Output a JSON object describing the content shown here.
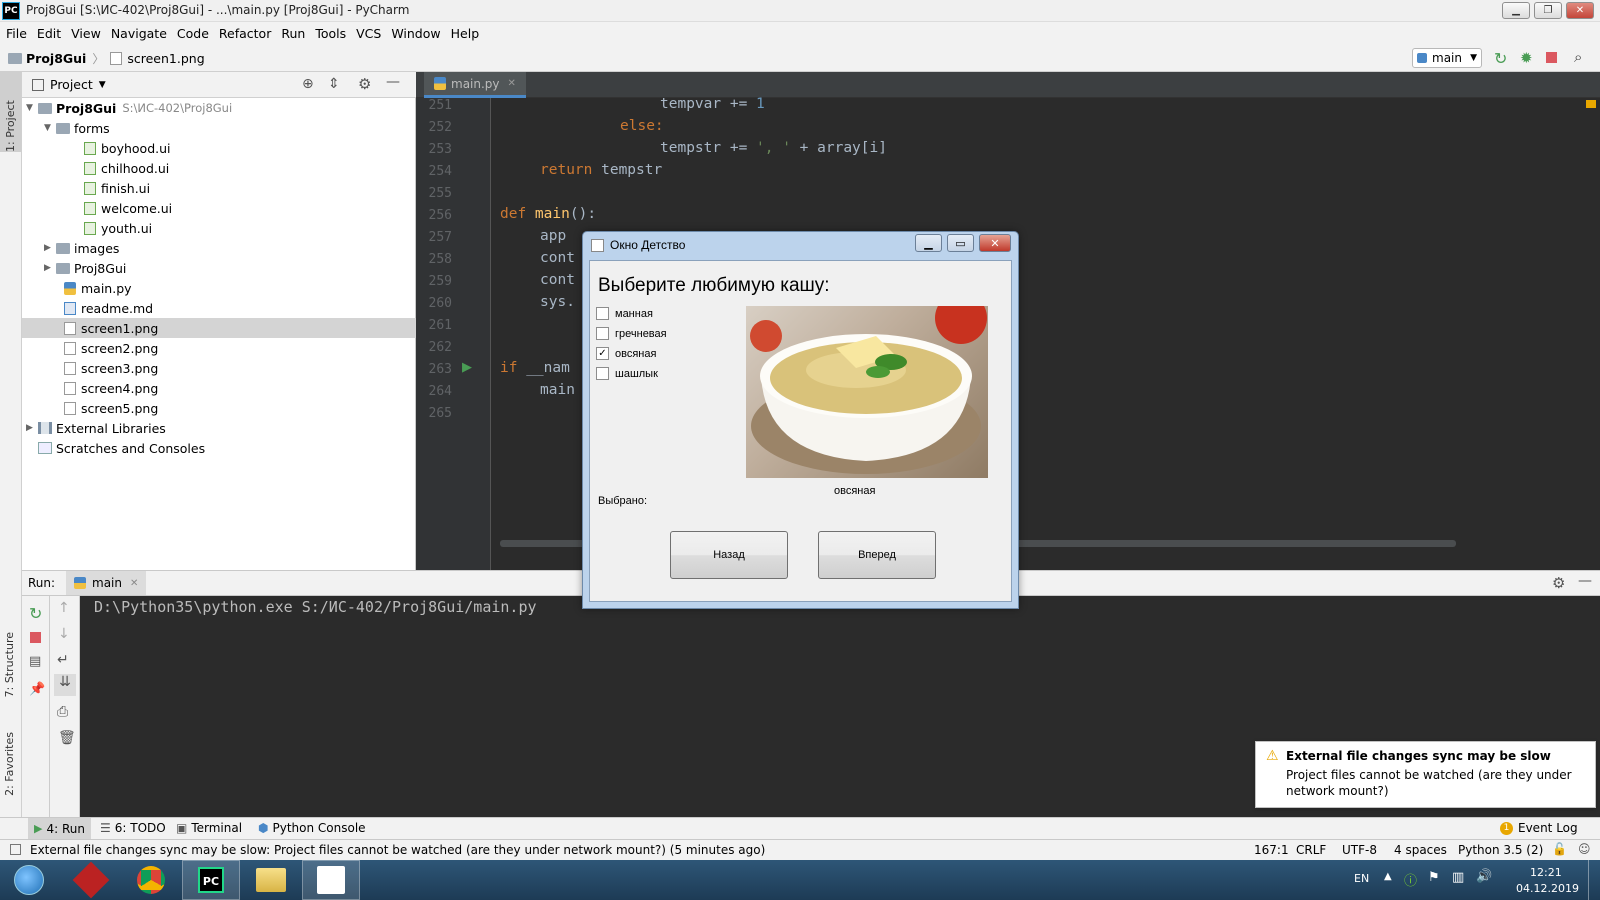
{
  "window": {
    "title": "Proj8Gui [S:\\ИС-402\\Proj8Gui] - ...\\main.py [Proj8Gui] - PyCharm",
    "logo": "PC"
  },
  "menu": [
    "File",
    "Edit",
    "View",
    "Navigate",
    "Code",
    "Refactor",
    "Run",
    "Tools",
    "VCS",
    "Window",
    "Help"
  ],
  "nav": {
    "project": "Proj8Gui",
    "file": "screen1.png",
    "run_config": "main"
  },
  "left_stripe": {
    "project": "1: Project",
    "structure": "7: Structure",
    "favorites": "2: Favorites"
  },
  "project_panel": {
    "title": "Project",
    "tree": [
      {
        "label": "Proj8Gui",
        "path": "S:\\ИС-402\\Proj8Gui",
        "bold": true
      },
      {
        "label": "forms"
      },
      {
        "label": "boyhood.ui"
      },
      {
        "label": "chilhood.ui"
      },
      {
        "label": "finish.ui"
      },
      {
        "label": "welcome.ui"
      },
      {
        "label": "youth.ui"
      },
      {
        "label": "images"
      },
      {
        "label": "Proj8Gui"
      },
      {
        "label": "main.py"
      },
      {
        "label": "readme.md"
      },
      {
        "label": "screen1.png"
      },
      {
        "label": "screen2.png"
      },
      {
        "label": "screen3.png"
      },
      {
        "label": "screen4.png"
      },
      {
        "label": "screen5.png"
      },
      {
        "label": "External Libraries"
      },
      {
        "label": "Scratches and Consoles"
      }
    ]
  },
  "editor": {
    "tab": "main.py",
    "line_numbers": [
      "251",
      "252",
      "253",
      "254",
      "255",
      "256",
      "257",
      "258",
      "259",
      "260",
      "261",
      "262",
      "263",
      "264",
      "265"
    ],
    "code": {
      "l251_a": "tempvar += ",
      "l251_b": "1",
      "l252": "else:",
      "l253_a": "tempstr += ",
      "l253_b": "', '",
      "l253_c": " + array[i]",
      "l254_a": "return",
      "l254_b": " tempstr",
      "l256_a": "def",
      "l256_b": " main",
      "l256_c": "():",
      "l257": "app",
      "l258": "cont",
      "l259": "cont",
      "l260": "sys.",
      "l263_a": "if",
      "l263_b": " __nam",
      "l264": "main"
    }
  },
  "run_panel": {
    "label": "Run:",
    "tab": "main",
    "console": "D:\\Python35\\python.exe S:/ИС-402/Proj8Gui/main.py"
  },
  "dialog": {
    "title": "Окно Детство",
    "heading": "Выберите любимую кашу:",
    "options": [
      {
        "label": "манная",
        "checked": false
      },
      {
        "label": "гречневая",
        "checked": false
      },
      {
        "label": "овсяная",
        "checked": true
      },
      {
        "label": "шашлык",
        "checked": false
      }
    ],
    "image_caption": "овсяная",
    "selected_label": "Выбрано:",
    "back_button": "Назад",
    "forward_button": "Вперед"
  },
  "notification": {
    "title": "External file changes sync may be slow",
    "body": "Project files cannot be watched (are they under network mount?)"
  },
  "tool_windows": {
    "run": "4: Run",
    "todo": "6: TODO",
    "terminal": "Terminal",
    "python_console": "Python Console",
    "event_log": "Event Log",
    "event_count": "1"
  },
  "status": {
    "message": "External file changes sync may be slow: Project files cannot be watched (are they under network mount?) (5 minutes ago)",
    "position": "167:1",
    "line_sep": "CRLF",
    "encoding": "UTF-8",
    "indent": "4 spaces",
    "interpreter": "Python 3.5 (2)"
  },
  "taskbar": {
    "lang": "EN",
    "time": "12:21",
    "date": "04.12.2019"
  },
  "colors": {
    "accent_blue": "#4a88c7",
    "run_green": "#499c54",
    "stop_red": "#db5860",
    "editor_bg": "#2b2b2b"
  }
}
